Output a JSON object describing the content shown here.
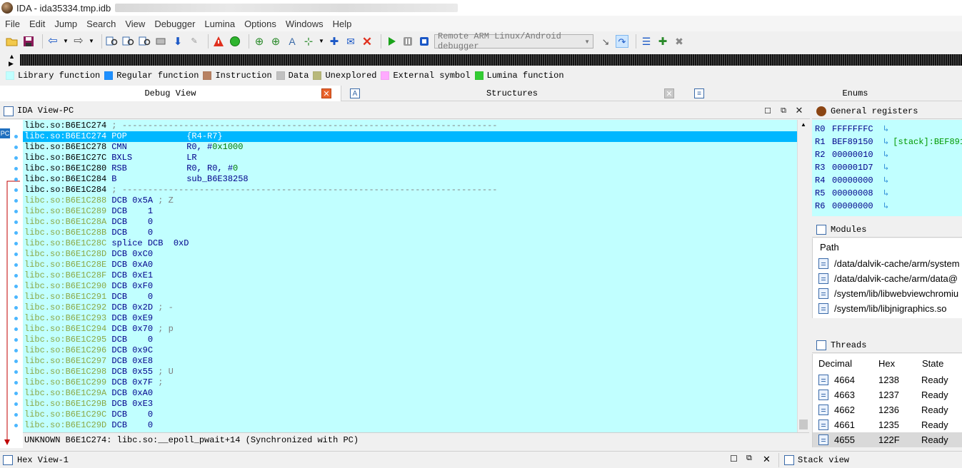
{
  "window": {
    "title": "IDA - ida35334.tmp.idb"
  },
  "menu": [
    "File",
    "Edit",
    "Jump",
    "Search",
    "View",
    "Debugger",
    "Lumina",
    "Options",
    "Windows",
    "Help"
  ],
  "toolbar": {
    "debugger_select": "Remote ARM Linux/Android debugger"
  },
  "legend": [
    {
      "label": "Library function",
      "color": "#c1ffff"
    },
    {
      "label": "Regular function",
      "color": "#1e90ff"
    },
    {
      "label": "Instruction",
      "color": "#b88263"
    },
    {
      "label": "Data",
      "color": "#c0c0c0"
    },
    {
      "label": "Unexplored",
      "color": "#b8b87a"
    },
    {
      "label": "External symbol",
      "color": "#ffaaff"
    },
    {
      "label": "Lumina function",
      "color": "#33cc33"
    }
  ],
  "tabs": {
    "debug_view": "Debug View",
    "structures": "Structures",
    "enums": "Enums"
  },
  "ida_view": {
    "title": "IDA View-PC",
    "pc_label": "PC",
    "lines": [
      {
        "addr": "libc.so:B6E1C274",
        "text": " ; -------------------------------------------------------------------------",
        "kind": "sep"
      },
      {
        "addr": "libc.so:B6E1C274",
        "mn": "POP",
        "ops": "{R4-R7}",
        "kind": "code",
        "hl": true
      },
      {
        "addr": "libc.so:B6E1C278",
        "mn": "CMN",
        "ops": "R0, #",
        "imm": "0x1000",
        "kind": "code"
      },
      {
        "addr": "libc.so:B6E1C27C",
        "mn": "BXLS",
        "ops": "LR",
        "kind": "code"
      },
      {
        "addr": "libc.so:B6E1C280",
        "mn": "RSB",
        "ops": "R0, R0, #",
        "imm": "0",
        "kind": "code"
      },
      {
        "addr": "libc.so:B6E1C284",
        "mn": "B",
        "ops": "sub_B6E38258",
        "kind": "code"
      },
      {
        "addr": "libc.so:B6E1C284",
        "text": " ; -------------------------------------------------------------------------",
        "kind": "sep"
      },
      {
        "addr": "libc.so:B6E1C288",
        "data": " DCB 0x5A",
        "cmt": " ; Z",
        "kind": "data"
      },
      {
        "addr": "libc.so:B6E1C289",
        "data": " DCB    1",
        "kind": "data"
      },
      {
        "addr": "libc.so:B6E1C28A",
        "data": " DCB    0",
        "kind": "data"
      },
      {
        "addr": "libc.so:B6E1C28B",
        "data": " DCB    0",
        "kind": "data"
      },
      {
        "addr": "libc.so:B6E1C28C",
        "data": " splice DCB  0xD",
        "kind": "data"
      },
      {
        "addr": "libc.so:B6E1C28D",
        "data": " DCB 0xC0",
        "kind": "data"
      },
      {
        "addr": "libc.so:B6E1C28E",
        "data": " DCB 0xA0",
        "kind": "data"
      },
      {
        "addr": "libc.so:B6E1C28F",
        "data": " DCB 0xE1",
        "kind": "data"
      },
      {
        "addr": "libc.so:B6E1C290",
        "data": " DCB 0xF0",
        "kind": "data"
      },
      {
        "addr": "libc.so:B6E1C291",
        "data": " DCB    0",
        "kind": "data"
      },
      {
        "addr": "libc.so:B6E1C292",
        "data": " DCB 0x2D",
        "cmt": " ; -",
        "kind": "data"
      },
      {
        "addr": "libc.so:B6E1C293",
        "data": " DCB 0xE9",
        "kind": "data"
      },
      {
        "addr": "libc.so:B6E1C294",
        "data": " DCB 0x70",
        "cmt": " ; p",
        "kind": "data"
      },
      {
        "addr": "libc.so:B6E1C295",
        "data": " DCB    0",
        "kind": "data"
      },
      {
        "addr": "libc.so:B6E1C296",
        "data": " DCB 0x9C",
        "kind": "data"
      },
      {
        "addr": "libc.so:B6E1C297",
        "data": " DCB 0xE8",
        "kind": "data"
      },
      {
        "addr": "libc.so:B6E1C298",
        "data": " DCB 0x55",
        "cmt": " ; U",
        "kind": "data"
      },
      {
        "addr": "libc.so:B6E1C299",
        "data": " DCB 0x7F",
        "cmt": " ;",
        "kind": "data"
      },
      {
        "addr": "libc.so:B6E1C29A",
        "data": " DCB 0xA0",
        "kind": "data"
      },
      {
        "addr": "libc.so:B6E1C29B",
        "data": " DCB 0xE3",
        "kind": "data"
      },
      {
        "addr": "libc.so:B6E1C29C",
        "data": " DCB    0",
        "kind": "data"
      },
      {
        "addr": "libc.so:B6E1C29D",
        "data": " DCB    0",
        "kind": "data"
      }
    ],
    "status": "UNKNOWN B6E1C274: libc.so:__epoll_pwait+14 (Synchronized with PC)"
  },
  "registers": {
    "title": "General registers",
    "rows": [
      {
        "name": "R0",
        "value": "FFFFFFFC",
        "extra": ""
      },
      {
        "name": "R1",
        "value": "BEF89150",
        "extra": "[stack]:BEF891"
      },
      {
        "name": "R2",
        "value": "00000010",
        "extra": ""
      },
      {
        "name": "R3",
        "value": "000001D7",
        "extra": ""
      },
      {
        "name": "R4",
        "value": "00000000",
        "extra": ""
      },
      {
        "name": "R5",
        "value": "00000008",
        "extra": ""
      },
      {
        "name": "R6",
        "value": "00000000",
        "extra": ""
      }
    ]
  },
  "modules": {
    "title": "Modules",
    "column": "Path",
    "items": [
      "/data/dalvik-cache/arm/system",
      "/data/dalvik-cache/arm/data@",
      "/system/lib/libwebviewchromiu",
      "/system/lib/libjnigraphics.so"
    ]
  },
  "threads": {
    "title": "Threads",
    "columns": [
      "Decimal",
      "Hex",
      "State"
    ],
    "rows": [
      {
        "dec": "4664",
        "hex": "1238",
        "state": "Ready"
      },
      {
        "dec": "4663",
        "hex": "1237",
        "state": "Ready"
      },
      {
        "dec": "4662",
        "hex": "1236",
        "state": "Ready"
      },
      {
        "dec": "4661",
        "hex": "1235",
        "state": "Ready"
      },
      {
        "dec": "4655",
        "hex": "122F",
        "state": "Ready"
      }
    ]
  },
  "bottom": {
    "hex_view": "Hex View-1",
    "stack_view": "Stack view"
  }
}
